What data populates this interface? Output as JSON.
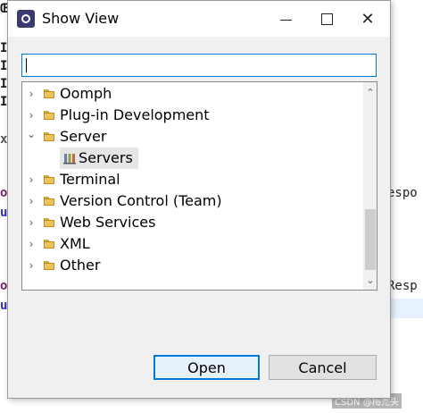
{
  "window": {
    "title": "Show View",
    "minimize_glyph": "",
    "close_glyph": "✕"
  },
  "search": {
    "value": "",
    "placeholder": ""
  },
  "tree": {
    "items": [
      {
        "label": "Oomph",
        "expanded": false,
        "icon": "folder-icon"
      },
      {
        "label": "Plug-in Development",
        "expanded": false,
        "icon": "folder-icon"
      },
      {
        "label": "Server",
        "expanded": true,
        "icon": "folder-icon"
      },
      {
        "label": "Servers",
        "child": true,
        "selected": true,
        "icon": "servers-icon"
      },
      {
        "label": "Terminal",
        "expanded": false,
        "icon": "folder-icon"
      },
      {
        "label": "Version Control (Team)",
        "expanded": false,
        "icon": "folder-icon"
      },
      {
        "label": "Web Services",
        "expanded": false,
        "icon": "folder-icon"
      },
      {
        "label": "XML",
        "expanded": false,
        "icon": "folder-icon"
      },
      {
        "label": "Other",
        "expanded": false,
        "icon": "folder-icon"
      }
    ],
    "collapsed_glyph": "›",
    "expanded_glyph": "⌄"
  },
  "scrollbar": {
    "up_glyph": "⌃",
    "down_glyph": "⌄"
  },
  "buttons": {
    "open": "Open",
    "cancel": "Cancel"
  },
  "background": {
    "left_fragments": [
      "Œ",
      "I",
      "I",
      "I",
      "I",
      "x",
      "o",
      "u",
      "o",
      "u"
    ],
    "right_fragments": [
      "espo",
      "Resp"
    ]
  },
  "watermark": "CSDN @梅禿头",
  "colors": {
    "accent": "#0078d7",
    "folder": "#f1c25c",
    "selection": "#e6e6e6"
  }
}
